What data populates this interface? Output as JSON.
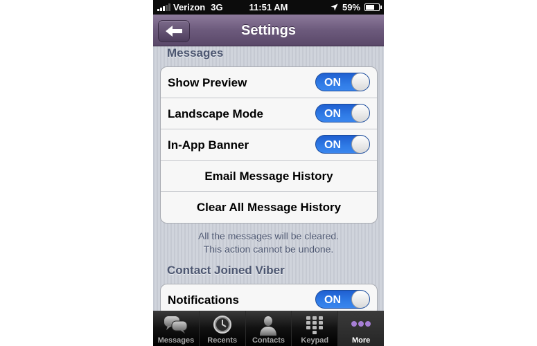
{
  "status_bar": {
    "carrier": "Verizon",
    "network": "3G",
    "time": "11:51 AM",
    "battery": "59%",
    "battery_level": 0.59
  },
  "nav": {
    "title": "Settings"
  },
  "messages_section": {
    "title": "Messages",
    "rows": [
      {
        "label": "Show Preview",
        "toggle": "ON"
      },
      {
        "label": "Landscape Mode",
        "toggle": "ON"
      },
      {
        "label": "In-App Banner",
        "toggle": "ON"
      },
      {
        "label": "Email Message History"
      },
      {
        "label": "Clear All Message History"
      }
    ],
    "footnote_line1": "All the messages will be cleared.",
    "footnote_line2": "This action cannot be undone."
  },
  "contact_section": {
    "title": "Contact Joined Viber",
    "rows": [
      {
        "label": "Notifications",
        "toggle": "ON"
      }
    ]
  },
  "tabbar": {
    "tabs": [
      {
        "label": "Messages",
        "icon": "speech-bubbles-icon"
      },
      {
        "label": "Recents",
        "icon": "clock-icon"
      },
      {
        "label": "Contacts",
        "icon": "person-icon"
      },
      {
        "label": "Keypad",
        "icon": "keypad-icon"
      },
      {
        "label": "More",
        "icon": "more-dots-icon"
      }
    ],
    "active_index": 4
  },
  "colors": {
    "toggle_on": "#2f7be6",
    "nav_purple": "#6c5a7c",
    "section_text": "#4c5670"
  }
}
